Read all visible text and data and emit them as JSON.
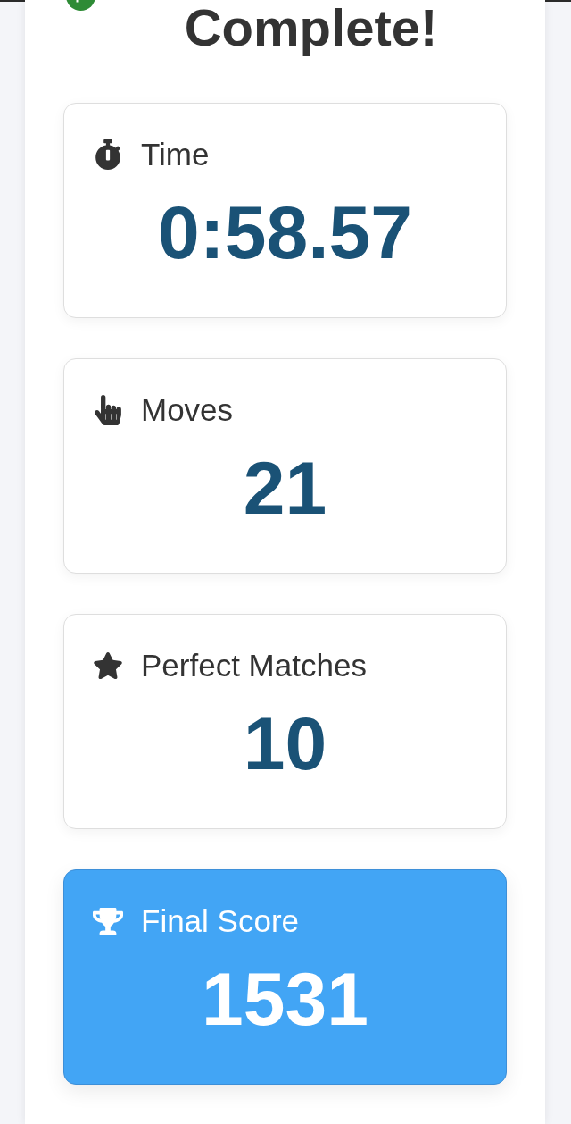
{
  "title": "Complete!",
  "stats": [
    {
      "kind": "time",
      "label": "Time",
      "value": "0:58.57",
      "highlighted": false
    },
    {
      "kind": "moves",
      "label": "Moves",
      "value": "21",
      "highlighted": false
    },
    {
      "kind": "perfect",
      "label": "Perfect Matches",
      "value": "10",
      "highlighted": false
    },
    {
      "kind": "score",
      "label": "Final Score",
      "value": "1531",
      "highlighted": true
    }
  ]
}
